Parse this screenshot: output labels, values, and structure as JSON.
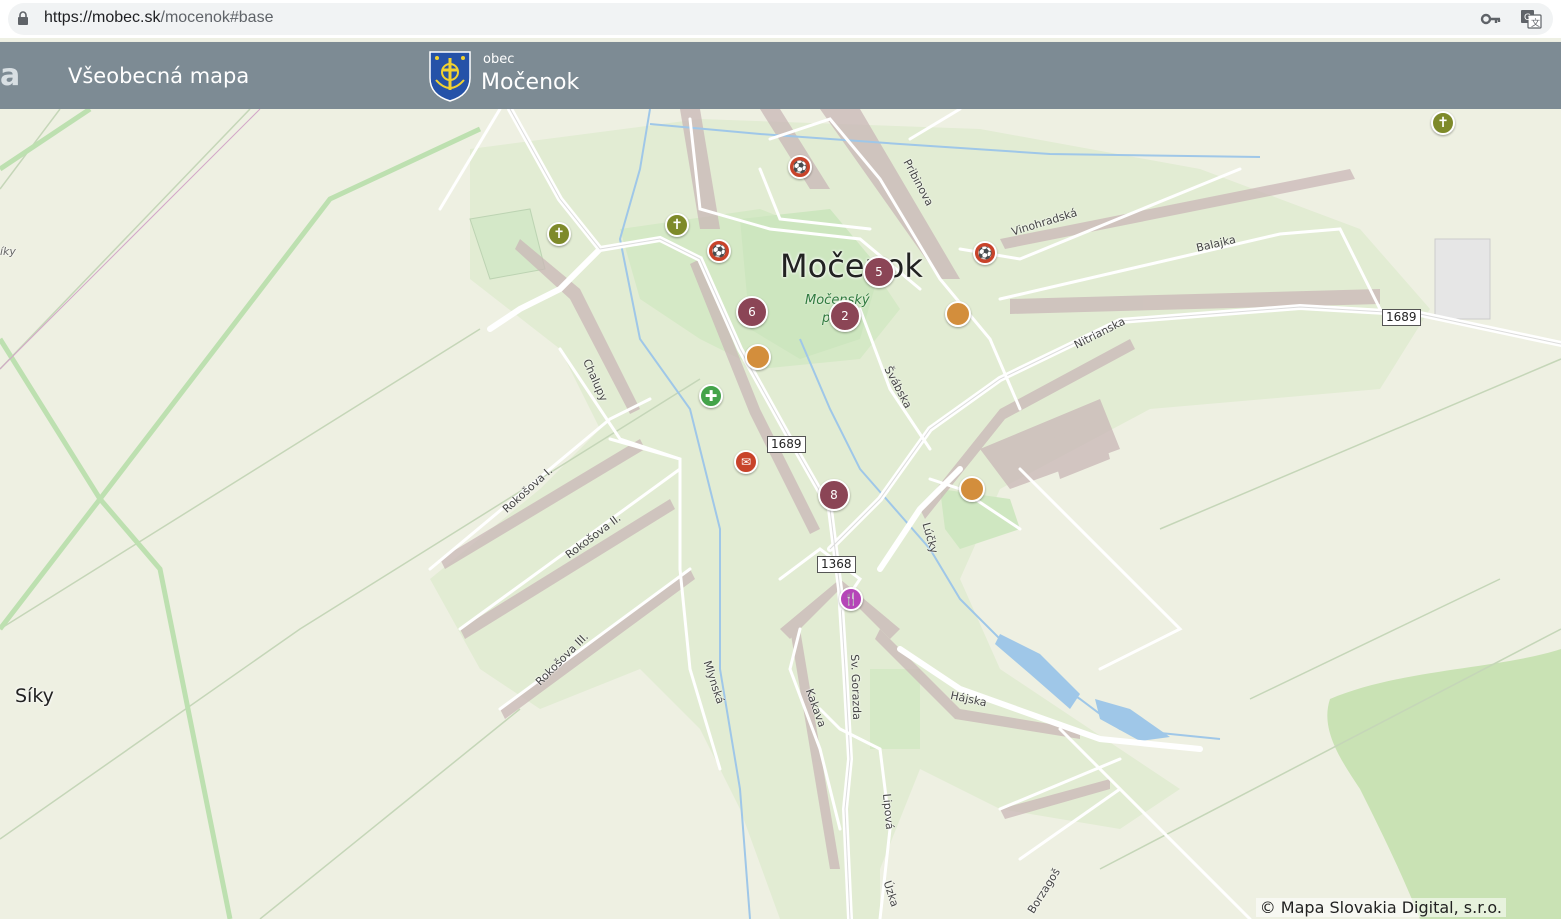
{
  "browser": {
    "url_host": "https://mobec.sk",
    "url_path": "/mocenok#base"
  },
  "header": {
    "edge_logo_text": "a",
    "title": "Všeobecná mapa",
    "municipality_type": "obec",
    "municipality_name": "Močenok"
  },
  "map": {
    "town_label": "Močenok",
    "park_label_line1": "Močenský",
    "park_label_line2": "p",
    "villages": [
      "Síky",
      "íky"
    ],
    "roads": {
      "pribinova": "Pribinova",
      "vinohradska": "Vinohradská",
      "balajka": "Balajka",
      "nitrianska": "Nitrianska",
      "chalupy": "Chalupy",
      "svabska": "Švábska",
      "lucky": "Lúčky",
      "rokosova1": "Rokošova I.",
      "rokosova2": "Rokošova II.",
      "rokosova3": "Rokošova III.",
      "mlynska": "Mlynská",
      "kakava": "Kakava",
      "sv_gorazda": "Sv. Gorazda",
      "hajska": "Hájska",
      "lipova": "Lipová",
      "uzka": "Úzka",
      "borzagos": "Borzagoš"
    },
    "road_numbers": [
      "1689",
      "1689",
      "1368"
    ],
    "clusters": [
      "5",
      "2",
      "6",
      "8"
    ],
    "marker_icons": {
      "church": "church-icon",
      "sport": "sport-icon",
      "pharmacy": "pharmacy-icon",
      "restaurant": "restaurant-icon",
      "office": "office-icon"
    },
    "colors": {
      "header_bg": "#7d8b94",
      "church_marker": "#7e8a2a",
      "sport_marker": "#c8432a",
      "cluster_marker": "#8b4556",
      "orange_marker": "#d38e3c",
      "pharmacy_marker": "#44a34a",
      "restaurant_marker": "#b545b8"
    },
    "attribution": "© Mapa Slovakia Digital, s.r.o."
  }
}
